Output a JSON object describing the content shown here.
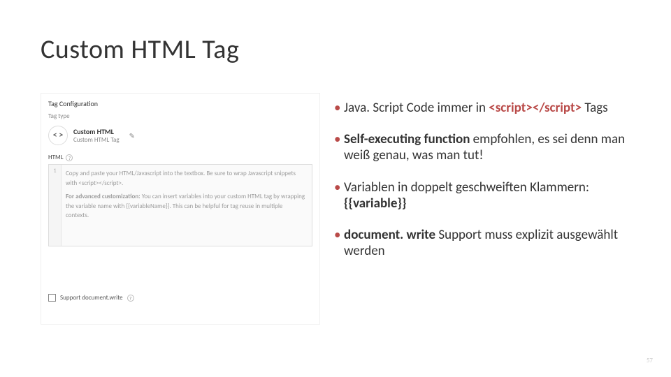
{
  "title": "Custom HTML Tag",
  "panel": {
    "section": "Tag Configuration",
    "tag_type_label": "Tag type",
    "tag_icon": "< >",
    "tag_name": "Custom HTML",
    "tag_sub": "Custom HTML Tag",
    "html_label": "HTML",
    "gutter": "1",
    "hint_p1_a": "Copy and paste your HTML/Javascript into the textbox. Be sure to wrap Javascript snippets with ",
    "hint_p1_b": "<script></script>.",
    "hint_p2_a": "For advanced customization: ",
    "hint_p2_b": "You can insert variables into your custom HTML tag by wrapping the variable name with {{variableName}}. This can be helpful for tag reuse in multiple contexts.",
    "checkbox_label": "Support document.write",
    "info": "?"
  },
  "bullets": {
    "b1_a": "Java. Script Code immer in ",
    "b1_b": "<script></script>",
    "b1_c": " Tags",
    "b2_a": "Self-executing function",
    "b2_b": " empfohlen, es sei denn man weiß genau, was man tut!",
    "b3_a": "Variablen in doppelt geschweiften Klammern: ",
    "b3_b": "{{variable}}",
    "b4_a": "document. write",
    "b4_b": " Support muss explizit ausgewählt werden"
  },
  "page": "57"
}
